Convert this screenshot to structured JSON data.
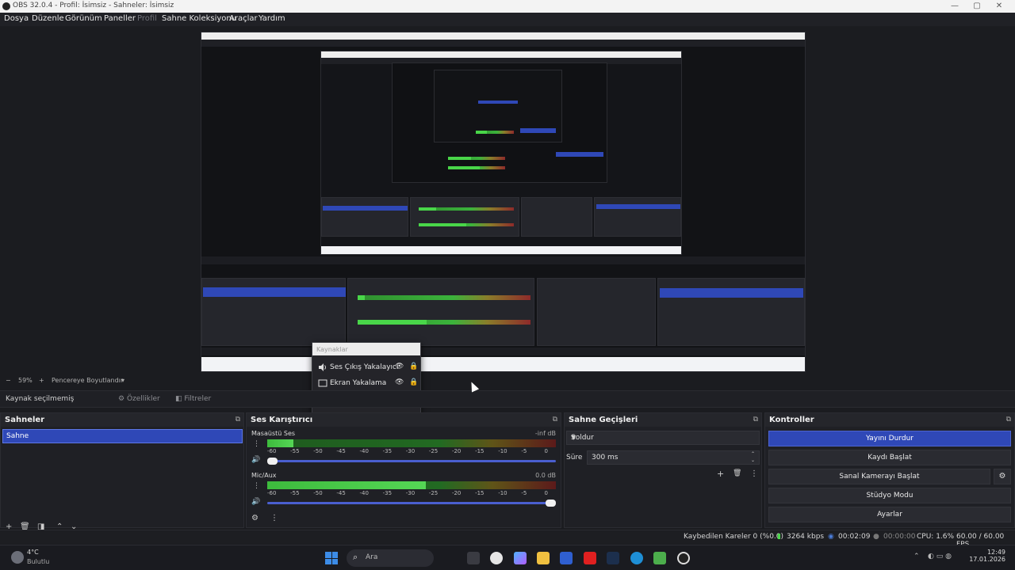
{
  "window": {
    "title": "OBS 32.0.4 - Profil: İsimsiz - Sahneler: İsimsiz"
  },
  "menu": [
    "Dosya",
    "Düzenle",
    "Görünüm",
    "Paneller",
    "Profil",
    "Sahne Koleksiyonu",
    "Araçlar",
    "Yardım"
  ],
  "zoom": {
    "minus": "−",
    "value": "59%",
    "plus": "+",
    "mode": "Pencereye Boyutlandır"
  },
  "source_bar": {
    "no_source": "Kaynak seçilmemiş",
    "properties": "Özellikler",
    "filters": "Filtreler"
  },
  "sources_popup": {
    "title": "Kaynaklar",
    "items": [
      {
        "label": "Ses Çıkış Yakalayıcı",
        "icon": "speaker-icon"
      },
      {
        "label": "Ekran Yakalama",
        "icon": "monitor-icon"
      }
    ]
  },
  "scenes": {
    "title": "Sahneler",
    "items": [
      "Sahne"
    ]
  },
  "mixer": {
    "title": "Ses Karıştırıcı",
    "channels": [
      {
        "name": "Masaüstü Ses",
        "db": "-inf dB",
        "level": 0.09
      },
      {
        "name": "Mic/Aux",
        "db": "0.0 dB",
        "level": 0.55
      }
    ],
    "ticks": [
      "-60",
      "-55",
      "-50",
      "-45",
      "-40",
      "-35",
      "-30",
      "-25",
      "-20",
      "-15",
      "-10",
      "-5",
      "0"
    ]
  },
  "transitions": {
    "title": "Sahne Geçişleri",
    "selected": "Soldur",
    "duration_label": "Süre",
    "duration_value": "300 ms"
  },
  "controls": {
    "title": "Kontroller",
    "buttons": [
      "Yayını Durdur",
      "Kaydı Başlat",
      "Sanal Kamerayı Başlat",
      "Stüdyo Modu",
      "Ayarlar"
    ]
  },
  "status": {
    "dropped": "Kaybedilen Kareler 0 (%0.0)",
    "bitrate": "3264 kbps",
    "stream_time": "00:02:09",
    "rec_time": "00:00:00",
    "cpu": "CPU: 1.6%",
    "fps": "60.00 / 60.00 FPS"
  },
  "taskbar": {
    "weather_temp": "4°C",
    "weather_desc": "Bulutlu",
    "search": "Ara",
    "time": "12:49",
    "date": "17.01.2026"
  },
  "colors": {
    "accent": "#2f48b7",
    "bg": "#1b1c20",
    "panel": "#1f2025"
  }
}
